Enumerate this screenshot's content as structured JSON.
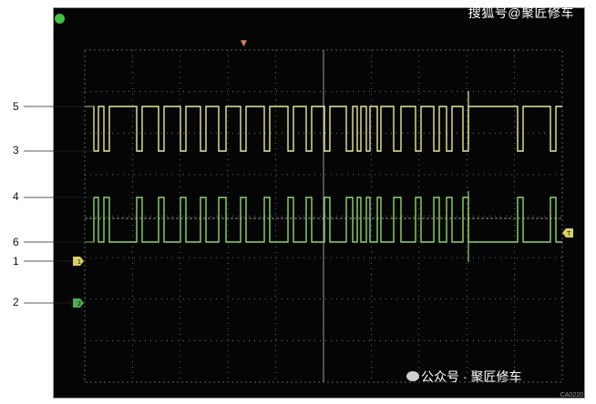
{
  "screen": {
    "watermark_top": "搜狐号@聚匠修车",
    "watermark_bottom": "公众号 · 聚匠修车",
    "image_code": "CA0220",
    "status_dot_color": "#3fc23f"
  },
  "callouts": {
    "line5": "5",
    "line3": "3",
    "line4": "4",
    "line6": "6",
    "line1": "1",
    "line2": "2"
  },
  "markers": {
    "ch1": "1",
    "ch2": "2",
    "trigger": "T",
    "trigger_pos": "▼"
  },
  "traces": {
    "ch1_color": "#e8e89a",
    "ch2_color": "#8fd66a",
    "grid_color": "#8a8a8a"
  }
}
